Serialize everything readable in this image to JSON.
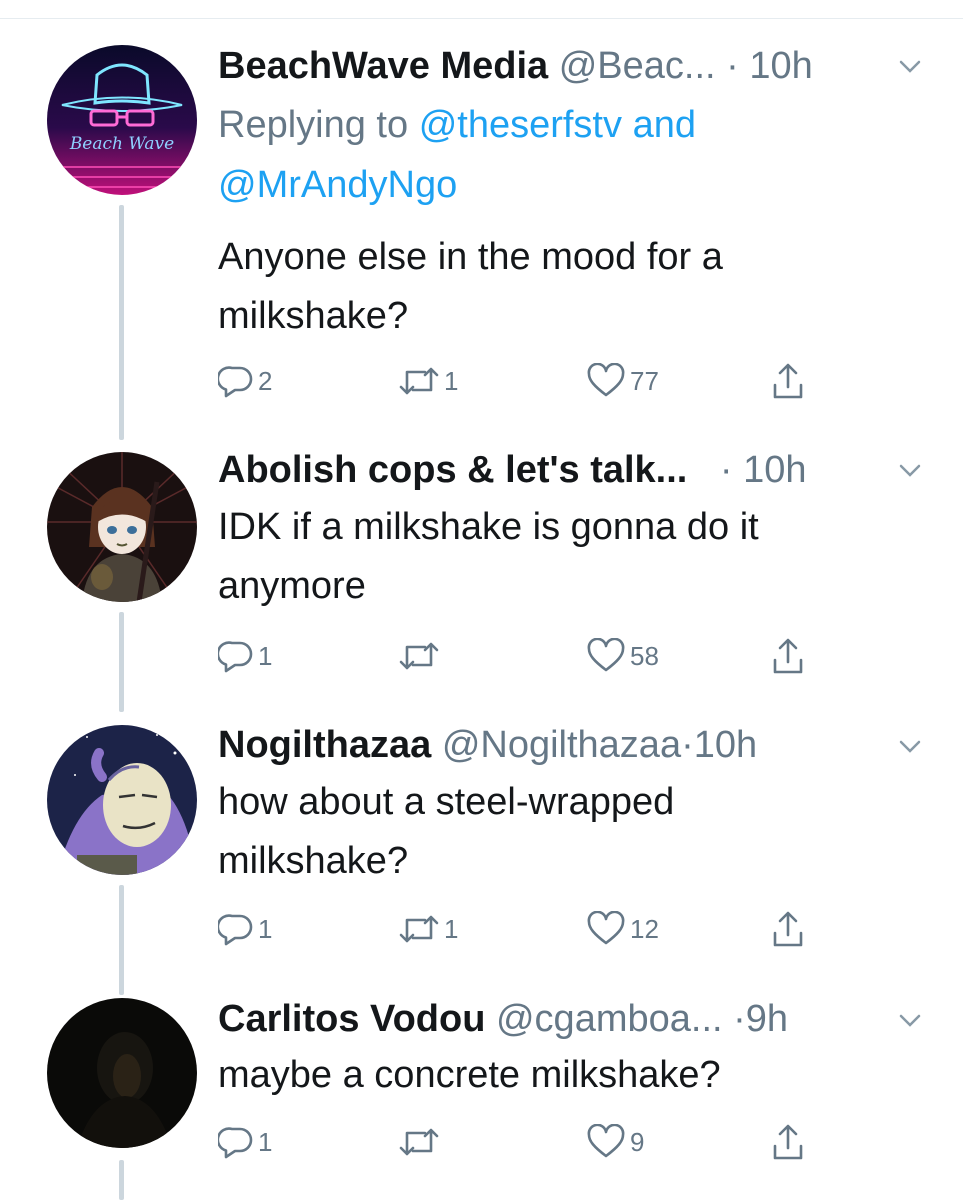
{
  "colors": {
    "text": "#14171a",
    "muted": "#657786",
    "link": "#1da1f2",
    "thread_line": "#ccd6dd"
  },
  "tweets": [
    {
      "name": "BeachWave Media",
      "handle": "@Beac...",
      "dot": "·",
      "time": "10h",
      "replying_prefix": "Replying to",
      "replying_mention1": "@theserfstv",
      "replying_and": "and",
      "replying_mention2": "@MrAndyNgo",
      "text_line1": "Anyone else in the mood for a",
      "text_line2": "milkshake?",
      "reply_count": "2",
      "retweet_count": "1",
      "like_count": "77",
      "avatar_icon": "beachwave-logo-avatar"
    },
    {
      "name": "Abolish cops & let's talk...",
      "handle": "",
      "dot": "·",
      "time": "10h",
      "text_line1": "IDK if a milkshake is gonna do it",
      "text_line2": "anymore",
      "reply_count": "1",
      "retweet_count": "",
      "like_count": "58",
      "avatar_icon": "anime-character-avatar"
    },
    {
      "name": "Nogilthazaa",
      "handle": "@Nogilthazaa",
      "dot": "·",
      "time": "10h",
      "text_line1": "how about a steel-wrapped",
      "text_line2": "milkshake?",
      "reply_count": "1",
      "retweet_count": "1",
      "like_count": "12",
      "avatar_icon": "cartoon-character-avatar"
    },
    {
      "name": "Carlitos Vodou",
      "handle": "@cgamboa...",
      "dot": "·",
      "time": "9h",
      "text_line1": "maybe a concrete milkshake?",
      "reply_count": "1",
      "retweet_count": "",
      "like_count": "9",
      "avatar_icon": "dark-portrait-avatar"
    }
  ]
}
